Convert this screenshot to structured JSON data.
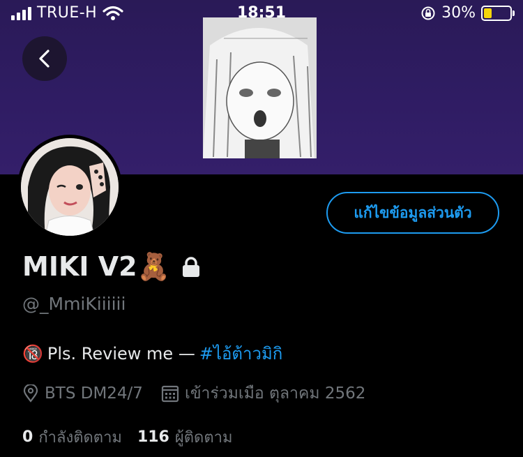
{
  "status_bar": {
    "carrier": "TRUE-H",
    "time": "18:51",
    "battery_percent": "30%",
    "battery_level": 0.3,
    "battery_color": "#f5d60a"
  },
  "colors": {
    "banner": "#2f1c63",
    "accent": "#1d9bf0",
    "muted_text": "#71767b",
    "background": "#000000"
  },
  "header": {
    "back_icon": "chevron-left-icon"
  },
  "profile": {
    "edit_button_label": "แก้ไขข้อมูลส่วนตัว",
    "display_name": "MIKI V2",
    "name_emoji": "🧸",
    "lock_icon": "lock-icon",
    "handle": "@_MmiKiiiiii",
    "bio_badge": "🔞",
    "bio_text": "Pls. Review me —",
    "bio_hashtag": "#ไอ้ต้าวมิกิ",
    "location": "BTS DM24/7",
    "joined": "เข้าร่วมเมือ ตุลาคม 2562",
    "following_count": "0",
    "following_label": "กำลังติดตาม",
    "followers_count": "116",
    "followers_label": "ผู้ติดตาม"
  }
}
